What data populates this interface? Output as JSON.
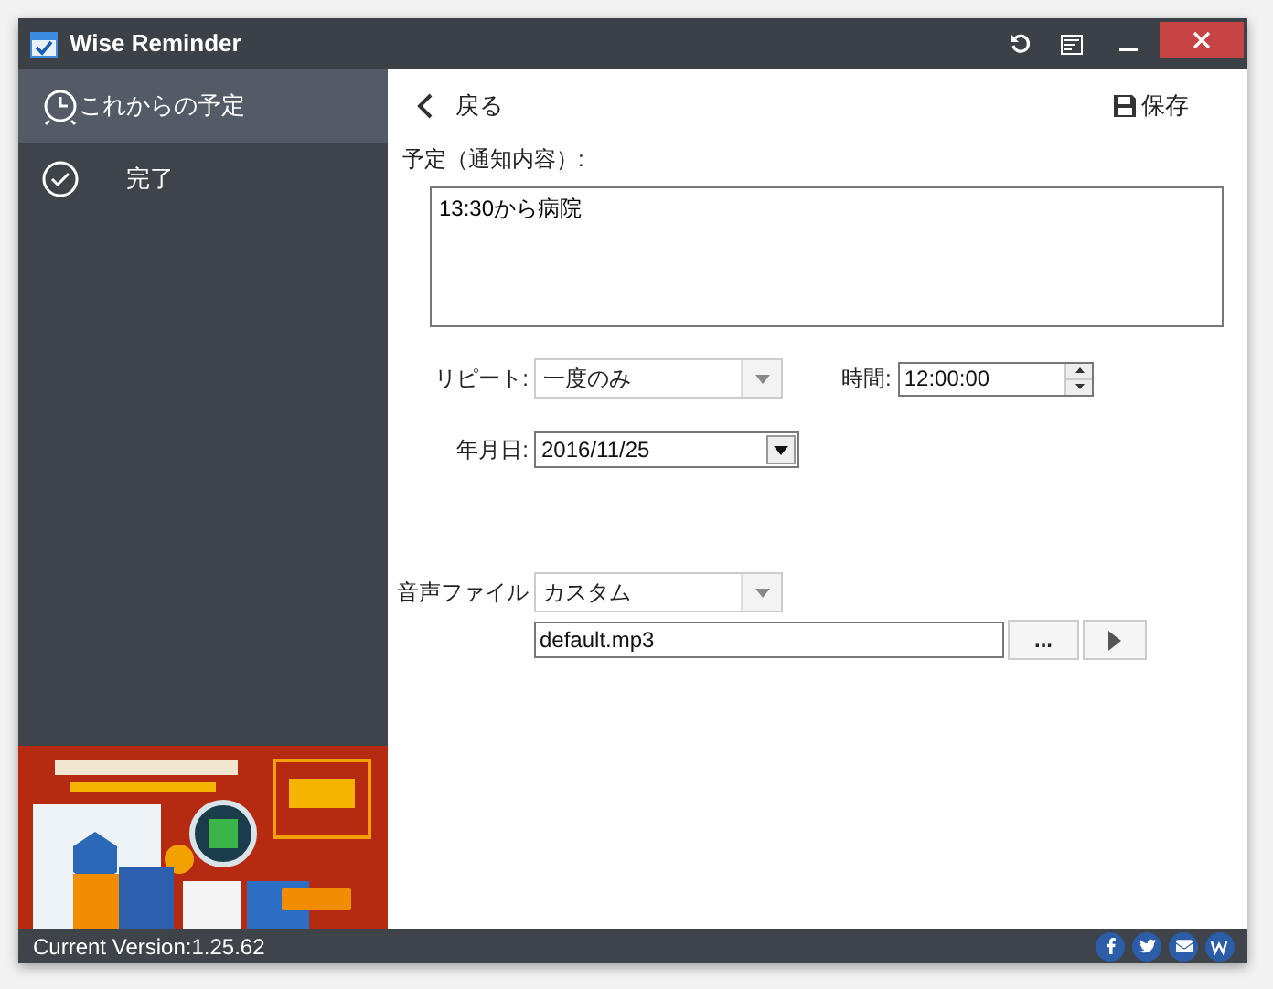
{
  "window": {
    "title": "Wise Reminder"
  },
  "sidebar": {
    "items": [
      {
        "label": "これからの予定",
        "kind": "clock",
        "selected": true
      },
      {
        "label": "完了",
        "kind": "check",
        "selected": false
      }
    ]
  },
  "toolbar": {
    "back": "戻る",
    "save": "保存"
  },
  "form": {
    "note_label": "予定（通知内容）:",
    "note_value": "13:30から病院",
    "repeat_label": "リピート:",
    "repeat_value": "一度のみ",
    "time_label": "時間:",
    "time_value": "12:00:00",
    "date_label": "年月日:",
    "date_value": "2016/11/25",
    "sound_label": "音声ファイル",
    "sound_value": "カスタム",
    "file_value": "default.mp3",
    "browse": "..."
  },
  "status_bar": {
    "version": "Current Version:1.25.62"
  }
}
